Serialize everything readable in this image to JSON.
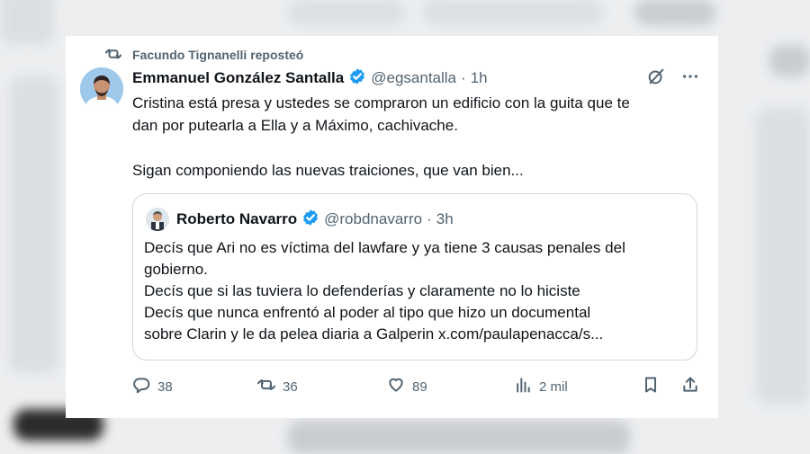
{
  "repost": {
    "text": "Facundo Tignanelli reposteó",
    "icon": "repost-icon"
  },
  "tweet": {
    "author_name": "Emmanuel González Santalla",
    "handle": "@egsantalla",
    "dot": "·",
    "time": "1h",
    "text": "Cristina está presa y ustedes se compraron un edificio con la guita que te\ndan por putearla a Ella y a Máximo, cachivache.\n\nSigan componiendo las nuevas traiciones, que van bien..."
  },
  "quote": {
    "author_name": "Roberto Navarro",
    "handle": "@robdnavarro",
    "dot": "·",
    "time": "3h",
    "lines": [
      "Decís que Ari no es víctima del lawfare y ya tiene 3 causas penales del",
      "gobierno.",
      "Decís que si las tuviera lo defenderías y claramente no lo hiciste",
      "Decís que nunca enfrentó al poder al tipo que hizo un documental",
      "sobre Clarin y le da pelea diaria a Galperin x.com/paulapenacca/s..."
    ]
  },
  "actions": {
    "replies": "38",
    "reposts": "36",
    "likes": "89",
    "views": "2 mil"
  },
  "colors": {
    "text": "#0f1419",
    "secondary": "#536471",
    "verified": "#1d9bf0",
    "border": "#cfd9de"
  }
}
